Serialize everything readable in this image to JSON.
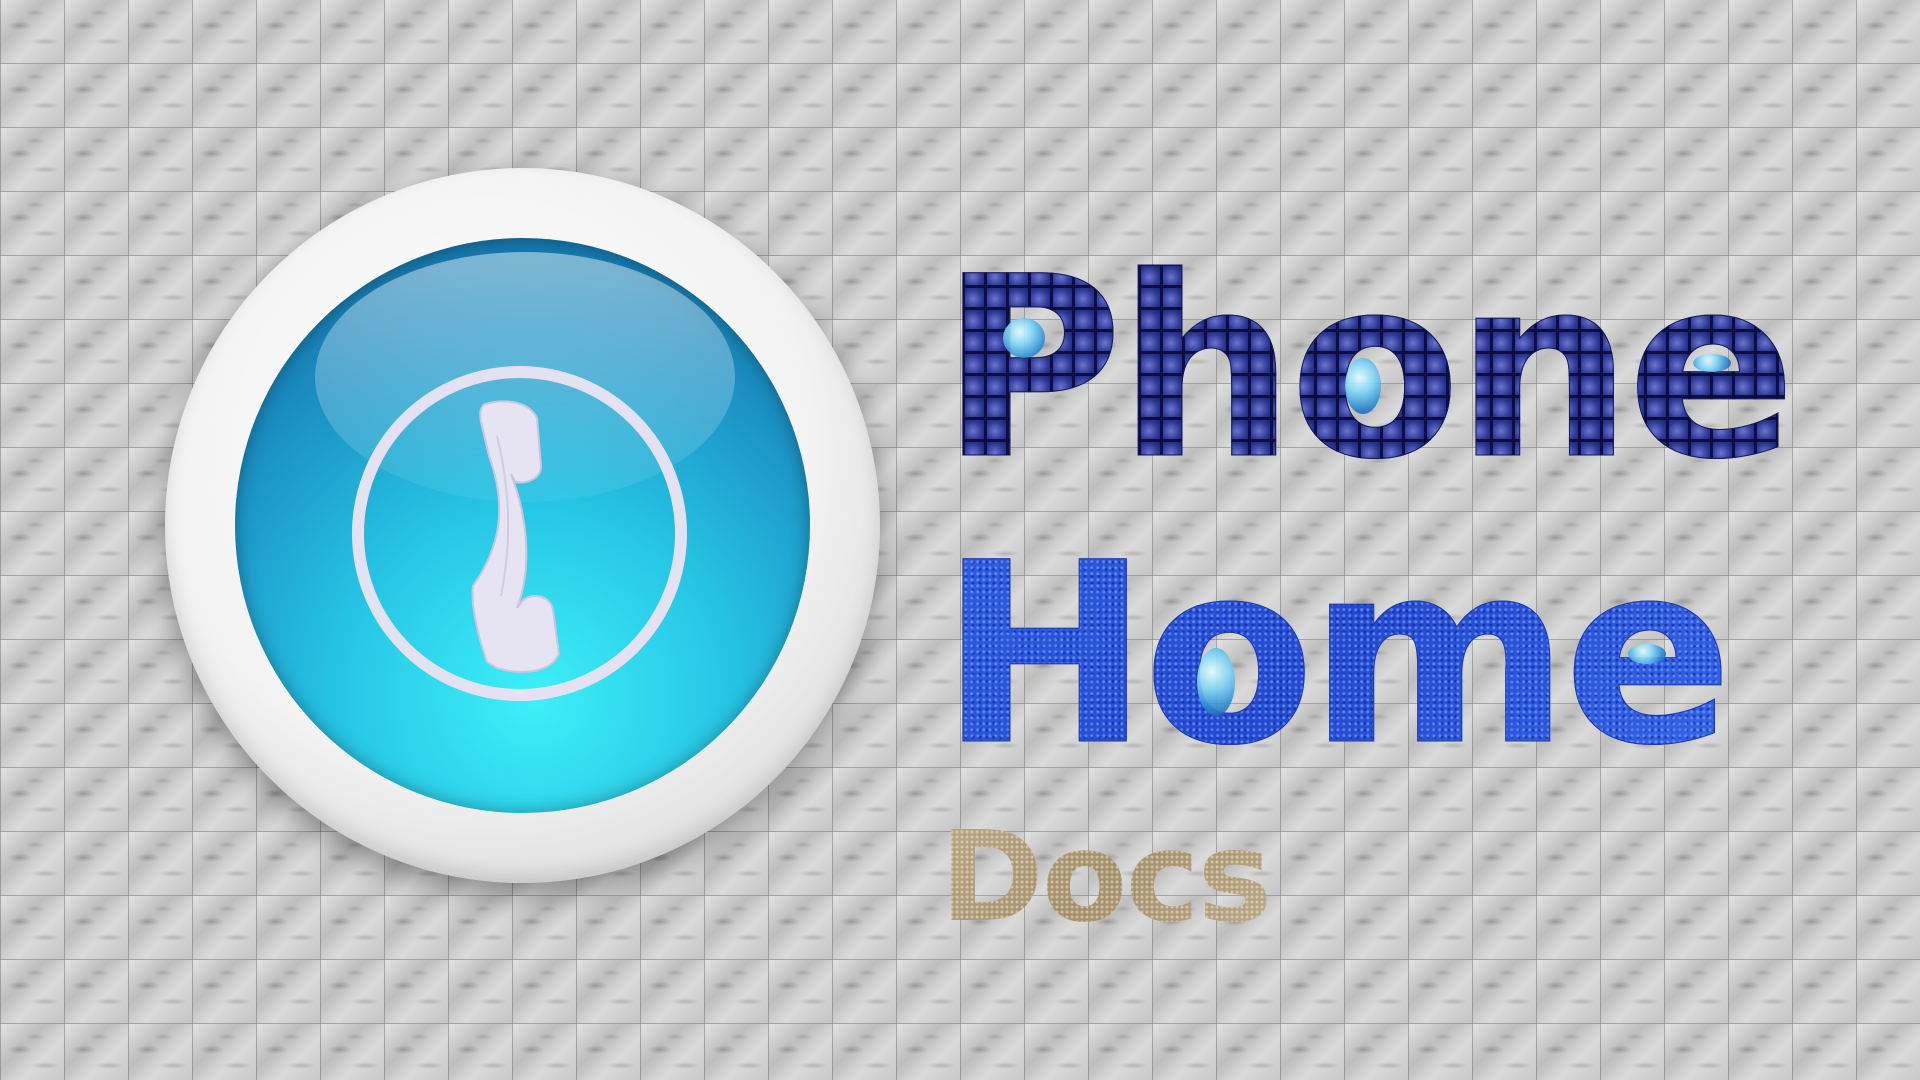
{
  "title": {
    "line1": "Phone",
    "line2": "Home",
    "line3": "Docs"
  },
  "logo": {
    "icon": "phone-handset-icon"
  },
  "colors": {
    "phone_text": "#2c3894",
    "home_text": "#2f5ee0",
    "docs_text": "#a28e6c",
    "icon_blue": "#1c93c6",
    "icon_cyan": "#3ef0f8"
  }
}
